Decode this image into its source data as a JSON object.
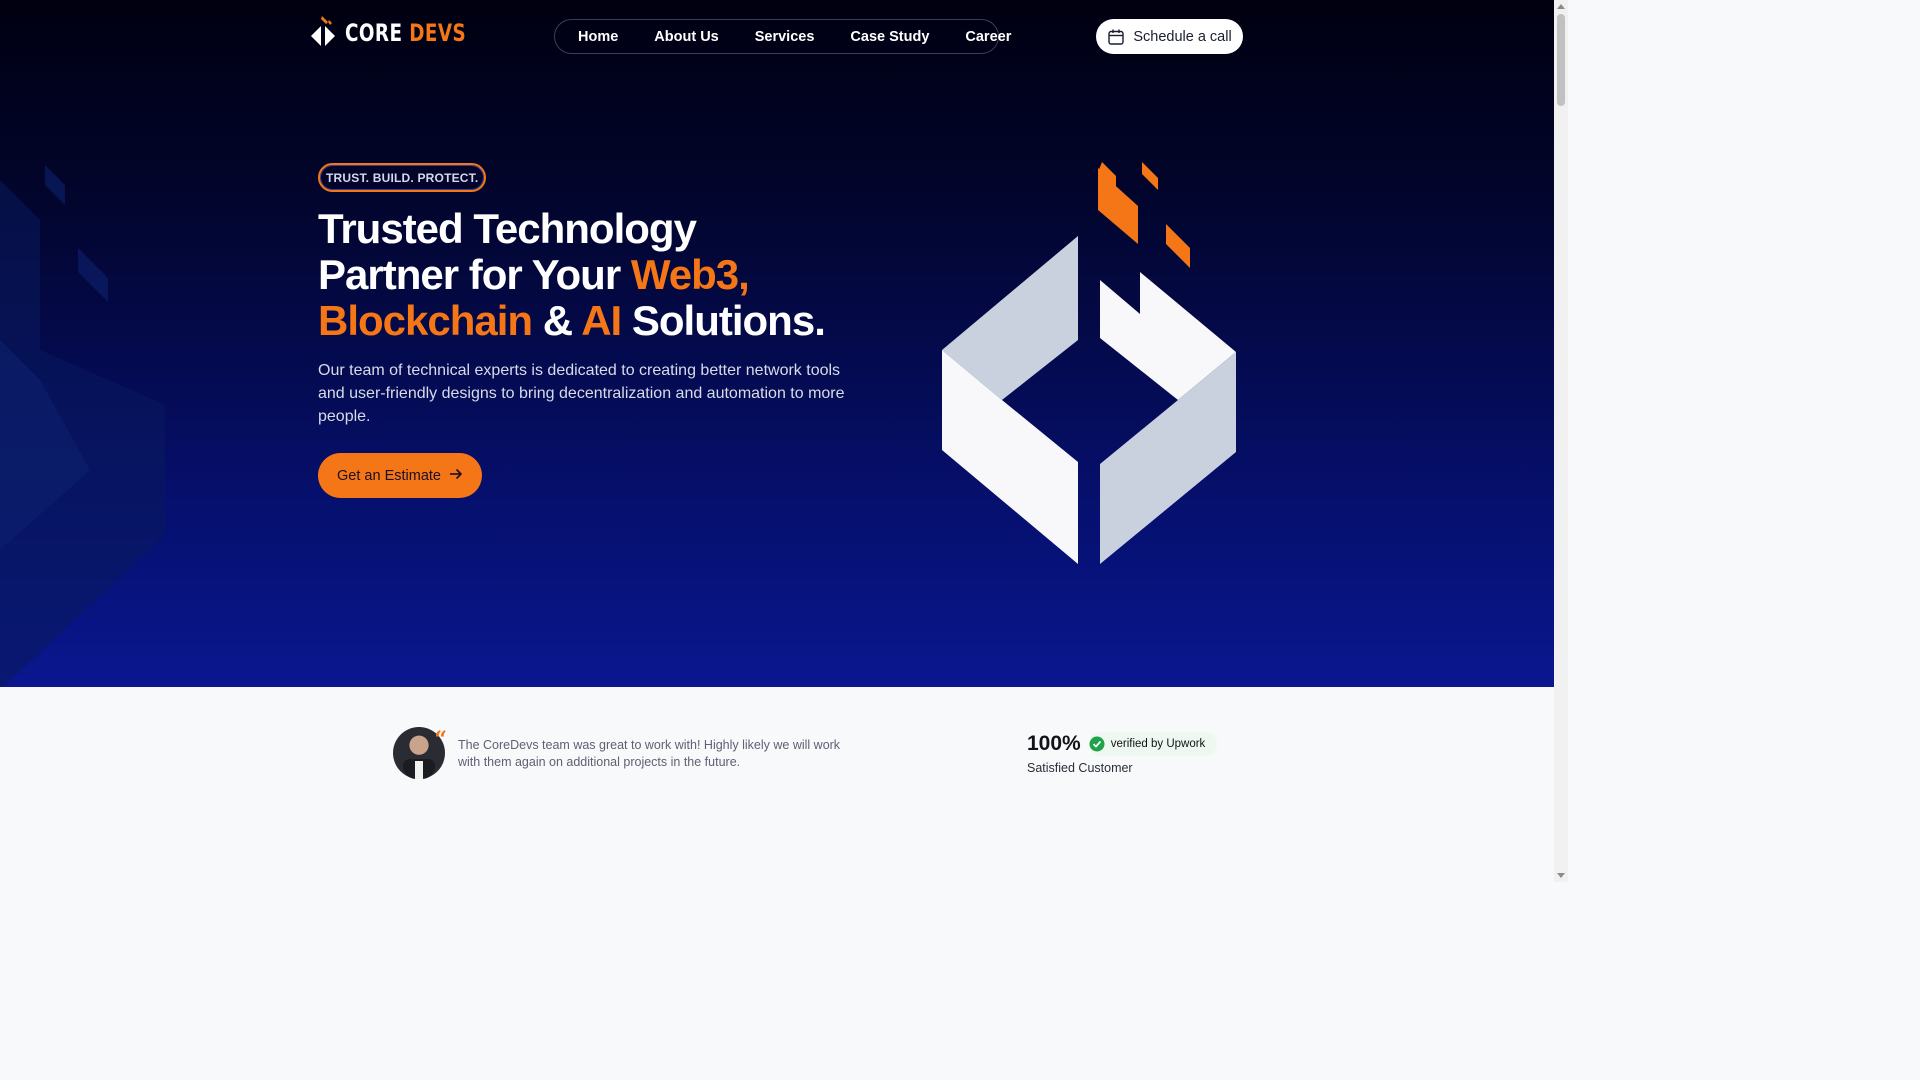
{
  "brand": {
    "name_part1": "CORE",
    "name_part2": "DEVS",
    "accent_color": "#f47617"
  },
  "nav": {
    "items": [
      {
        "label": "Home",
        "active": true
      },
      {
        "label": "About Us"
      },
      {
        "label": "Services"
      },
      {
        "label": "Case Study"
      },
      {
        "label": "Career"
      }
    ]
  },
  "header": {
    "schedule_label": "Schedule a call",
    "schedule_icon": "calendar-icon"
  },
  "hero": {
    "tag": "TRUST. BUILD. PROTECT.",
    "headline": {
      "part1": "Trusted Technology",
      "part2": "Partner for Your ",
      "accent1": "Web3,",
      "accent2": "Blockchain",
      "part3": " & ",
      "accent3": "AI",
      "part4": " Solutions."
    },
    "description": "Our team of technical experts is dedicated to creating better network tools and user-friendly designs to bring decentralization and automation to more people.",
    "cta_label": "Get an Estimate",
    "cta_icon": "arrow-right-icon"
  },
  "testimonial": {
    "quote": "The CoreDevs team was great to work with! Highly likely we will work with them again on additional projects in the future.",
    "quote_icon": "quote-icon"
  },
  "stat": {
    "value": "100%",
    "badge": "verified by Upwork",
    "badge_icon": "check-badge-icon",
    "label": "Satisfied Customer"
  }
}
